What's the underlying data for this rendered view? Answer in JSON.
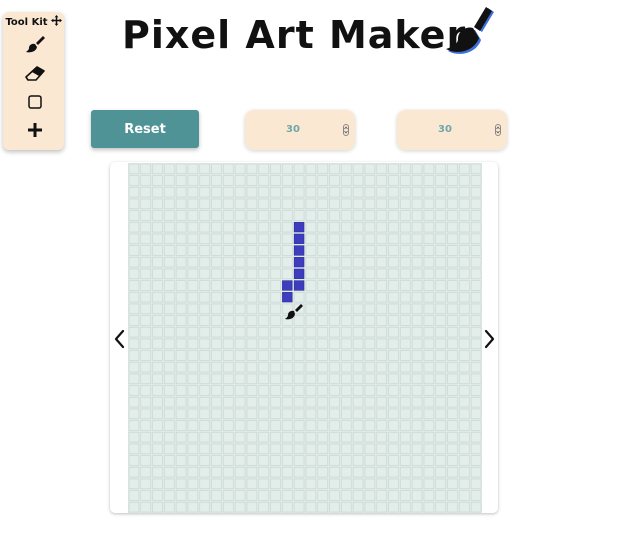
{
  "app": {
    "title": "Pixel Art Maker"
  },
  "toolkit": {
    "title": "Tool Kit",
    "tools": [
      {
        "name": "brush-tool",
        "icon": "paintbrush-icon"
      },
      {
        "name": "eraser-tool",
        "icon": "eraser-icon"
      },
      {
        "name": "shape-tool",
        "icon": "square-icon"
      },
      {
        "name": "add-tool",
        "icon": "plus-icon"
      }
    ]
  },
  "controls": {
    "reset_label": "Reset",
    "height_value": "30",
    "width_value": "30"
  },
  "grid": {
    "rows": 30,
    "cols": 30,
    "cell_color": "#e3eeeb",
    "paint_color": "#3d3dbd",
    "filled_cells": [
      {
        "row": 5,
        "col": 14
      },
      {
        "row": 6,
        "col": 14
      },
      {
        "row": 7,
        "col": 14
      },
      {
        "row": 8,
        "col": 14
      },
      {
        "row": 9,
        "col": 14
      },
      {
        "row": 10,
        "col": 13
      },
      {
        "row": 10,
        "col": 14
      },
      {
        "row": 11,
        "col": 13
      }
    ]
  },
  "colors": {
    "toolkit_bg": "#fbe8d3",
    "reset_bg": "#4f9396",
    "accent_blue": "#3e6fd9"
  }
}
